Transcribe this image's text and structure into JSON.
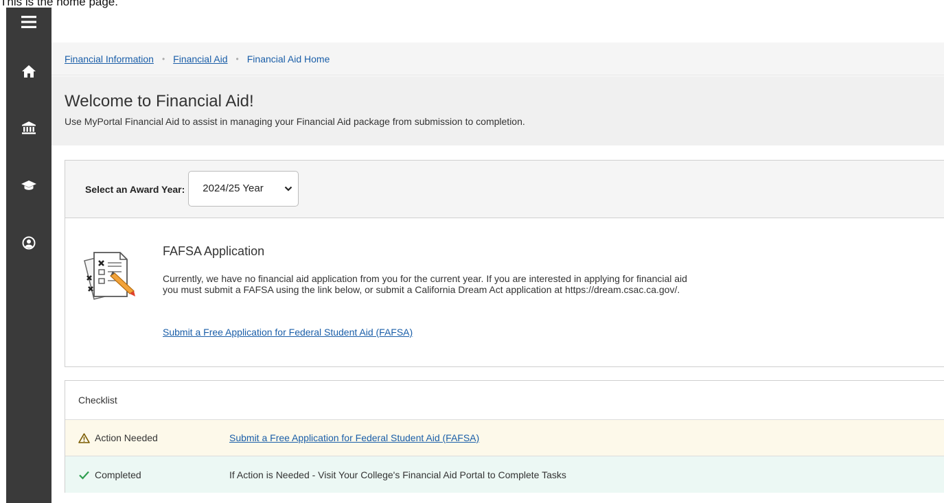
{
  "caption": "This is the home page.",
  "sidebar": {
    "items": [
      {
        "icon": "hamburger-menu-icon"
      },
      {
        "icon": "home-icon"
      },
      {
        "icon": "bank-icon"
      },
      {
        "icon": "graduation-cap-icon"
      },
      {
        "icon": "user-circle-icon"
      }
    ]
  },
  "breadcrumb": {
    "items": [
      "Financial Information",
      "Financial Aid"
    ],
    "current": "Financial Aid Home",
    "separator": "•"
  },
  "header": {
    "title": "Welcome to Financial Aid!",
    "subtitle": "Use MyPortal Financial Aid to assist in managing your Financial Aid package from submission to completion."
  },
  "award_year": {
    "label": "Select an Award Year:",
    "selected": "2024/25 Year"
  },
  "fafsa": {
    "icon": "checklist-pencil-icon",
    "title": "FAFSA Application",
    "body": "Currently, we have no financial aid application from you for the current year. If you are interested in applying for financial aid you must submit a FAFSA using the link below, or submit a California Dream Act application at https://dream.csac.ca.gov/.",
    "link": "Submit a Free Application for Federal Student Aid (FAFSA)"
  },
  "checklist": {
    "title": "Checklist",
    "rows": [
      {
        "status": "Action Needed",
        "icon": "warning-triangle-icon",
        "value": "Submit a Free Application for Federal Student Aid (FAFSA)"
      },
      {
        "status": "Completed",
        "icon": "checkmark-icon",
        "value": "If Action is Needed - Visit Your College's Financial Aid Portal to Complete Tasks"
      }
    ]
  },
  "colors": {
    "sidebar": "#3a3a3a",
    "link": "#1a5ea8",
    "warning_row": "#fdf9ea",
    "completed_row": "#ecf8f4",
    "check_green": "#2e9e4f",
    "warning_amber": "#7a5b00"
  }
}
